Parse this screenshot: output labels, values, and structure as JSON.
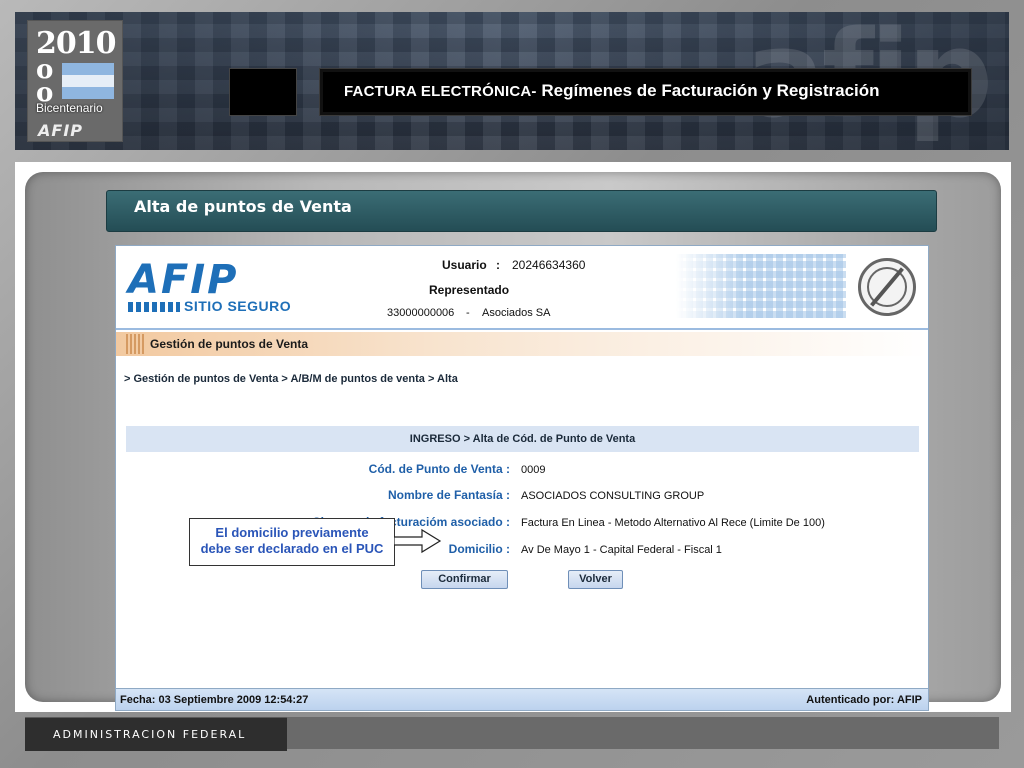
{
  "header": {
    "logo": {
      "year": "2010",
      "caption": "Bicentenario",
      "brand": "AFIP"
    },
    "title_part1": "FACTURA ELECTRÓNICA-",
    "title_part2": " Regímenes de Facturación y Registración"
  },
  "section": {
    "title": "Alta de puntos de Venta"
  },
  "afip": {
    "logo_text": "AFIP",
    "sitio_seguro": "SITIO SEGURO",
    "usuario_label": "Usuario",
    "usuario_colon": ":",
    "usuario_value": "20246634360",
    "representado_label": "Representado",
    "representado_cuit": "33000000006",
    "representado_sep": "-",
    "representado_name": "Asociados SA"
  },
  "gestion": {
    "title": "Gestión de puntos de Venta",
    "breadcrumb": "> Gestión de puntos de Venta > A/B/M de puntos de venta > Alta"
  },
  "form": {
    "title": "INGRESO > Alta de Cód. de Punto de Venta",
    "fields": [
      {
        "label": "Cód. de Punto de Venta :",
        "value": "0009"
      },
      {
        "label": "Nombre de Fantasía :",
        "value": "ASOCIADOS CONSULTING GROUP"
      },
      {
        "label": "Sistema de facturacióm asociado :",
        "value": "Factura En Linea - Metodo Alternativo Al Rece (Limite De 100)"
      },
      {
        "label": "Domicilio :",
        "value": "Av De Mayo 1 - Capital Federal - Fiscal 1"
      }
    ],
    "confirm_label": "Confirmar",
    "back_label": "Volver"
  },
  "footer": {
    "fecha": "Fecha: 03 Septiembre 2009 12:54:27",
    "autenticado": "Autenticado por: AFIP"
  },
  "callout": {
    "line1": "El domicilio previamente",
    "line2": "debe ser declarado en el PUC"
  },
  "bottom": {
    "text": "ADMINISTRACION FEDERAL"
  },
  "colors": {
    "section_bar": "#2d5c64",
    "label_blue": "#1f5fa8",
    "callout_blue": "#2a55b8"
  }
}
